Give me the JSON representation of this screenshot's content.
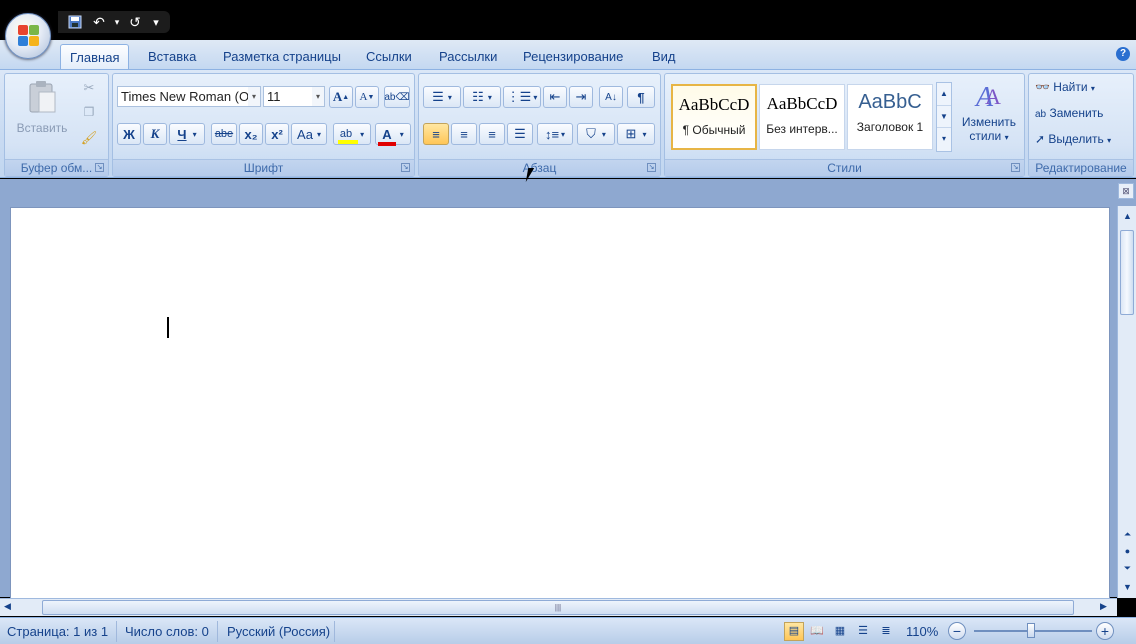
{
  "window": {
    "title": ""
  },
  "qat": {
    "save": "save-icon",
    "undo": "↶",
    "redo": "↺",
    "customize": "▾"
  },
  "tabs": [
    {
      "label": "Главная",
      "active": true
    },
    {
      "label": "Вставка",
      "active": false
    },
    {
      "label": "Разметка страницы",
      "active": false
    },
    {
      "label": "Ссылки",
      "active": false
    },
    {
      "label": "Рассылки",
      "active": false
    },
    {
      "label": "Рецензирование",
      "active": false
    },
    {
      "label": "Вид",
      "active": false
    }
  ],
  "help": "?",
  "clipboard": {
    "label": "Буфер обм...",
    "paste": "Вставить"
  },
  "font": {
    "label": "Шрифт",
    "name": "Times New Roman (О",
    "size": "11",
    "bold": "Ж",
    "italic": "К",
    "underline": "Ч",
    "strike": "abe",
    "sub": "x₂",
    "sup": "x²",
    "case": "Aa",
    "grow": "A",
    "shrink": "A",
    "color_letter": "A"
  },
  "paragraph": {
    "label": "Абзац",
    "pilcrow": "¶"
  },
  "styles": {
    "label": "Стили",
    "items": [
      {
        "preview": "AaBbCcD",
        "name": "¶ Обычный"
      },
      {
        "preview": "AaBbCcD",
        "name": "Без интерв..."
      },
      {
        "preview": "AaBbC",
        "name": "Заголовок 1"
      }
    ],
    "change_line1": "Изменить",
    "change_line2": "стили"
  },
  "editing": {
    "label": "Редактирование",
    "find": "Найти",
    "replace": "Заменить",
    "select": "Выделить"
  },
  "status": {
    "page": "Страница: 1 из 1",
    "words": "Число слов: 0",
    "language": "Русский (Россия)",
    "zoom": "110%",
    "minus": "−",
    "plus": "+"
  },
  "colors": {
    "accent": "#15428b",
    "highlight": "#ffff00",
    "font_color": "#e00000"
  }
}
